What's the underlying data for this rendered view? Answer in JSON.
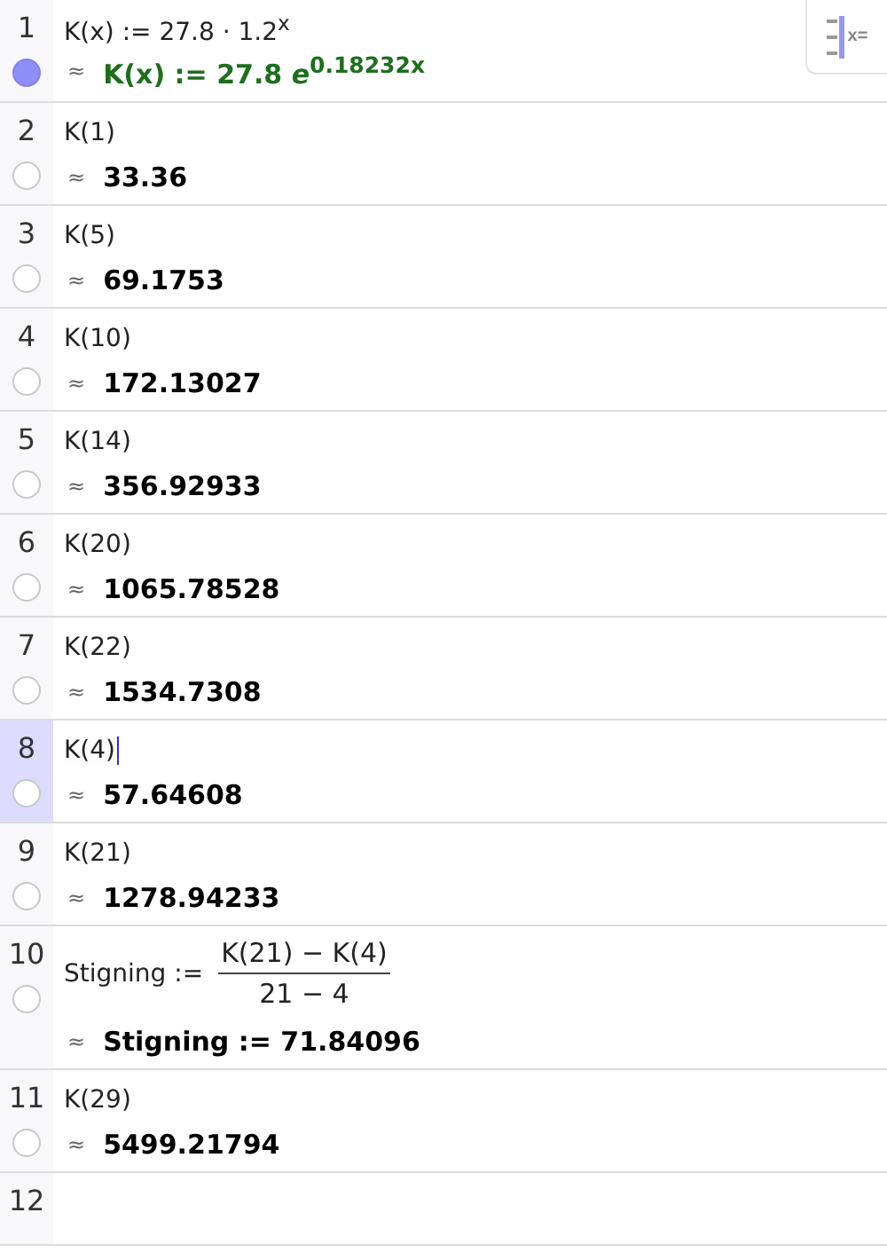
{
  "style_bar": {
    "label": "x="
  },
  "rows": [
    {
      "number": "1",
      "kind": "plain",
      "input": "K(x) := 27.8 · 1.2$^{x}$",
      "approx": "≈",
      "output": "K(x) := 27.8 *e*$^{0.18232x}$",
      "color": "#1e6e1e",
      "visible": true,
      "selected": false,
      "editing": false
    },
    {
      "number": "2",
      "kind": "plain",
      "input": "K(1)",
      "approx": "≈",
      "output": "33.36",
      "color": "#000000",
      "visible": false,
      "selected": false,
      "editing": false
    },
    {
      "number": "3",
      "kind": "plain",
      "input": "K(5)",
      "approx": "≈",
      "output": "69.1753",
      "color": "#000000",
      "visible": false,
      "selected": false,
      "editing": false
    },
    {
      "number": "4",
      "kind": "plain",
      "input": "K(10)",
      "approx": "≈",
      "output": "172.13027",
      "color": "#000000",
      "visible": false,
      "selected": false,
      "editing": false
    },
    {
      "number": "5",
      "kind": "plain",
      "input": "K(14)",
      "approx": "≈",
      "output": "356.92933",
      "color": "#000000",
      "visible": false,
      "selected": false,
      "editing": false
    },
    {
      "number": "6",
      "kind": "plain",
      "input": "K(20)",
      "approx": "≈",
      "output": "1065.78528",
      "color": "#000000",
      "visible": false,
      "selected": false,
      "editing": false
    },
    {
      "number": "7",
      "kind": "plain",
      "input": "K(22)",
      "approx": "≈",
      "output": "1534.7308",
      "color": "#000000",
      "visible": false,
      "selected": false,
      "editing": false
    },
    {
      "number": "8",
      "kind": "plain",
      "input": "K(4)",
      "approx": "≈",
      "output": "57.64608",
      "color": "#000000",
      "visible": false,
      "selected": true,
      "editing": true
    },
    {
      "number": "9",
      "kind": "plain",
      "input": "K(21)",
      "approx": "≈",
      "output": "1278.94233",
      "color": "#000000",
      "visible": false,
      "selected": false,
      "editing": false
    },
    {
      "number": "10",
      "kind": "fraction",
      "input": "Stigning :=",
      "numerator": "K(21) − K(4)",
      "denominator": "21 − 4",
      "approx": "≈",
      "output": "Stigning := 71.84096",
      "color": "#000000",
      "visible": false,
      "selected": false,
      "editing": false
    },
    {
      "number": "11",
      "kind": "plain",
      "input": "K(29)",
      "approx": "≈",
      "output": "5499.21794",
      "color": "#000000",
      "visible": false,
      "selected": false,
      "editing": false
    },
    {
      "number": "12",
      "kind": "empty",
      "selected": false
    }
  ]
}
